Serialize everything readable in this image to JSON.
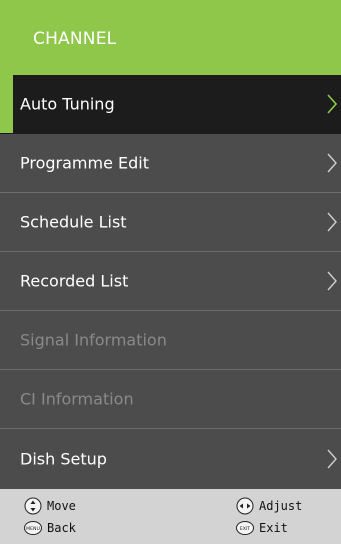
{
  "menu": {
    "title": "CHANNEL",
    "items": [
      {
        "label": "Auto Tuning",
        "state": "selected",
        "has_submenu": true
      },
      {
        "label": "Programme Edit",
        "state": "normal",
        "has_submenu": true
      },
      {
        "label": "Schedule List",
        "state": "normal",
        "has_submenu": true
      },
      {
        "label": "Recorded List",
        "state": "normal",
        "has_submenu": true
      },
      {
        "label": "Signal Information",
        "state": "disabled",
        "has_submenu": false
      },
      {
        "label": "CI Information",
        "state": "disabled",
        "has_submenu": false
      },
      {
        "label": "Dish Setup",
        "state": "normal",
        "has_submenu": true
      }
    ]
  },
  "footer": {
    "move_label": "Move",
    "adjust_label": "Adjust",
    "back_label": "Back",
    "exit_label": "Exit",
    "menu_key": "MENU",
    "exit_key": "EXIT"
  },
  "colors": {
    "accent": "#8fc74a",
    "selected_bg": "#1c1c1c",
    "item_bg": "#4c4c4c",
    "disabled_text": "#8a8a8a",
    "footer_bg": "#d3d3d3"
  }
}
